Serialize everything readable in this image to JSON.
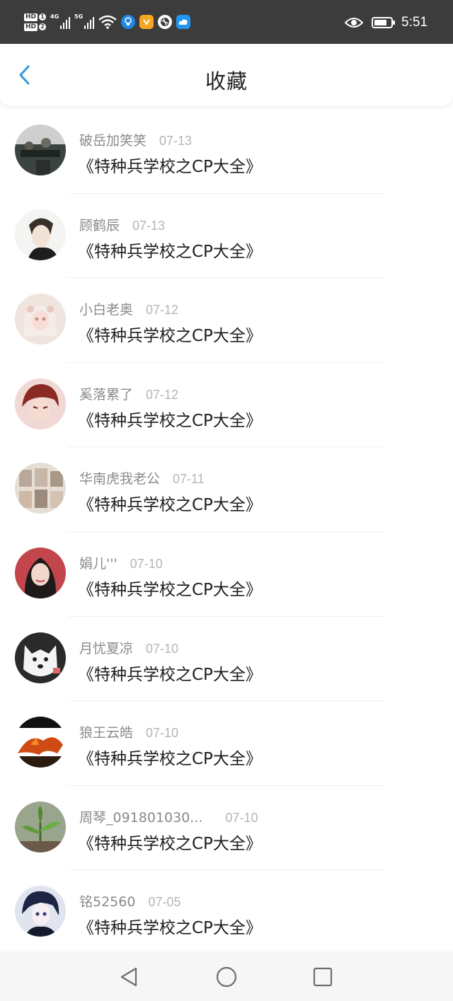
{
  "status_bar": {
    "sim1": "HD",
    "sim1_slot": "1",
    "sim2": "HD",
    "sim2_slot": "2",
    "net1": "4G",
    "net2": "5G",
    "time": "5:51",
    "battery_level": 0.75,
    "icons": [
      "signal-icon",
      "signal-icon",
      "wifi-icon",
      "bulb-app-icon",
      "shield-app-icon",
      "ball-app-icon",
      "cloud-app-icon",
      "eye-icon",
      "battery-icon"
    ]
  },
  "header": {
    "back_icon": "chevron-left-icon",
    "title": "收藏",
    "accent_color": "#2d9cdb"
  },
  "favorites": [
    {
      "user": "破岳加笑笑",
      "date": "07-13",
      "title": "《特种兵学校之CP大全》"
    },
    {
      "user": "顾鹤辰",
      "date": "07-13",
      "title": "《特种兵学校之CP大全》"
    },
    {
      "user": "小白老奥",
      "date": "07-12",
      "title": "《特种兵学校之CP大全》"
    },
    {
      "user": "奚落累了",
      "date": "07-12",
      "title": "《特种兵学校之CP大全》"
    },
    {
      "user": "华南虎我老公",
      "date": "07-11",
      "title": "《特种兵学校之CP大全》"
    },
    {
      "user": "娟儿'''",
      "date": "07-10",
      "title": "《特种兵学校之CP大全》"
    },
    {
      "user": "月忧夏凉",
      "date": "07-10",
      "title": "《特种兵学校之CP大全》"
    },
    {
      "user": "狼王云皓",
      "date": "07-10",
      "title": "《特种兵学校之CP大全》"
    },
    {
      "user": "周琴_091801030...",
      "date": "07-10",
      "title": "《特种兵学校之CP大全》"
    },
    {
      "user": "铭52560",
      "date": "07-05",
      "title": "《特种兵学校之CP大全》"
    }
  ],
  "nav_bar": {
    "back": "triangle-back-icon",
    "home": "circle-home-icon",
    "recents": "square-recents-icon"
  }
}
